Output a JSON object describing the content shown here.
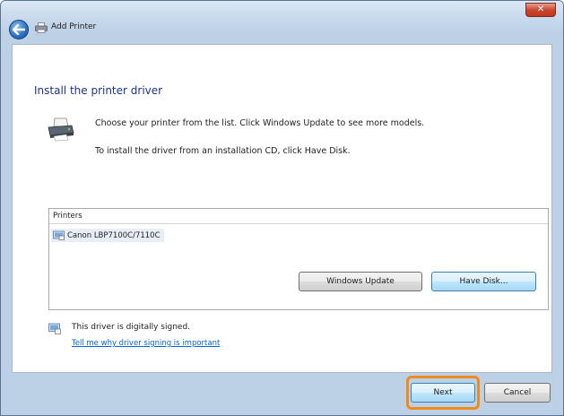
{
  "window": {
    "title": "Add Printer",
    "close_label": "✕"
  },
  "page": {
    "heading": "Install the printer driver",
    "intro_line1": "Choose your printer from the list. Click Windows Update to see more models.",
    "intro_line2": "To install the driver from an installation CD, click Have Disk."
  },
  "printers_list": {
    "header": "Printers",
    "items": [
      {
        "label": "Canon LBP7100C/7110C",
        "selected": true
      }
    ]
  },
  "driver_info": {
    "signed_text": "This driver is digitally signed.",
    "signing_link": "Tell me why driver signing is important"
  },
  "buttons": {
    "windows_update": "Windows Update",
    "have_disk": "Have Disk...",
    "next": "Next",
    "cancel": "Cancel"
  },
  "colors": {
    "heading": "#1e3287",
    "link": "#0066cc",
    "highlight": "#f08a1c"
  }
}
